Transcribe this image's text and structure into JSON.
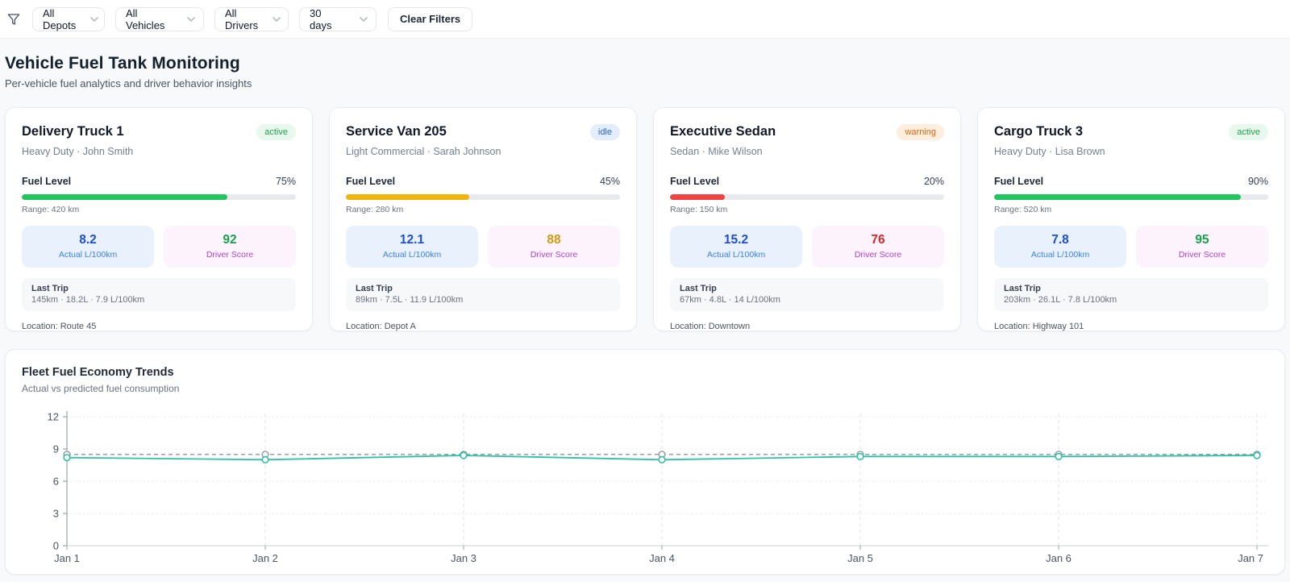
{
  "filters": {
    "dropdowns": [
      {
        "id": "depots",
        "value": "All Depots"
      },
      {
        "id": "vehicles",
        "value": "All Vehicles"
      },
      {
        "id": "drivers",
        "value": "All Drivers"
      },
      {
        "id": "period",
        "value": "30 days"
      }
    ],
    "clear_label": "Clear Filters"
  },
  "header": {
    "title": "Vehicle Fuel Tank Monitoring",
    "subtitle": "Per-vehicle fuel analytics and driver behavior insights"
  },
  "labels": {
    "fuel_level": "Fuel Level",
    "actual": "Actual L/100km",
    "driver_score": "Driver Score",
    "last_trip": "Last Trip"
  },
  "vehicles": [
    {
      "name": "Delivery Truck 1",
      "status": "active",
      "status_bg": "#e8f8ee",
      "status_color": "#1fa24a",
      "subtitle": "Heavy Duty · John Smith",
      "fuel_percent": "75%",
      "fuel_color": "#22c55e",
      "range": "Range: 420 km",
      "actual": "8.2",
      "score": "92",
      "score_color": "#16a34a",
      "last_trip": "145km · 18.2L · 7.9 L/100km",
      "location": "Location: Route 45"
    },
    {
      "name": "Service Van 205",
      "status": "idle",
      "status_bg": "#e4edfc",
      "status_color": "#2563eb",
      "subtitle": "Light Commercial · Sarah Johnson",
      "fuel_percent": "45%",
      "fuel_color": "#f0b40d",
      "range": "Range: 280 km",
      "actual": "12.1",
      "score": "88",
      "score_color": "#d49a0c",
      "last_trip": "89km · 7.5L · 11.9 L/100km",
      "location": "Location: Depot A"
    },
    {
      "name": "Executive Sedan",
      "status": "warning",
      "status_bg": "#feeede",
      "status_color": "#ea620e",
      "subtitle": "Sedan · Mike Wilson",
      "fuel_percent": "20%",
      "fuel_color": "#ef4444",
      "range": "Range: 150 km",
      "actual": "15.2",
      "score": "76",
      "score_color": "#dc2626",
      "last_trip": "67km · 4.8L · 14 L/100km",
      "location": "Location: Downtown"
    },
    {
      "name": "Cargo Truck 3",
      "status": "active",
      "status_bg": "#e8f8ee",
      "status_color": "#1fa24a",
      "subtitle": "Heavy Duty · Lisa Brown",
      "fuel_percent": "90%",
      "fuel_color": "#22c55e",
      "range": "Range: 520 km",
      "actual": "7.8",
      "score": "95",
      "score_color": "#16a34a",
      "last_trip": "203km · 26.1L · 7.8 L/100km",
      "location": "Location: Highway 101"
    }
  ],
  "chart_data": {
    "type": "line",
    "title": "Fleet Fuel Economy Trends",
    "subtitle": "Actual vs predicted fuel consumption",
    "x": [
      "Jan 1",
      "Jan 2",
      "Jan 3",
      "Jan 4",
      "Jan 5",
      "Jan 6",
      "Jan 7"
    ],
    "series": [
      {
        "name": "actual",
        "values": [
          8.2,
          8.0,
          8.4,
          8.0,
          8.3,
          8.3,
          8.4
        ],
        "color": "#2fc2a7",
        "style": "solid"
      },
      {
        "name": "predicted",
        "values": [
          8.5,
          8.5,
          8.5,
          8.5,
          8.5,
          8.5,
          8.5
        ],
        "color": "#98a2ad",
        "style": "dashed"
      }
    ],
    "ylabel": "",
    "xlabel": "",
    "ylim": [
      0,
      12
    ],
    "yticks": [
      0,
      3,
      6,
      9,
      12
    ],
    "grid": true,
    "legend": "none"
  }
}
